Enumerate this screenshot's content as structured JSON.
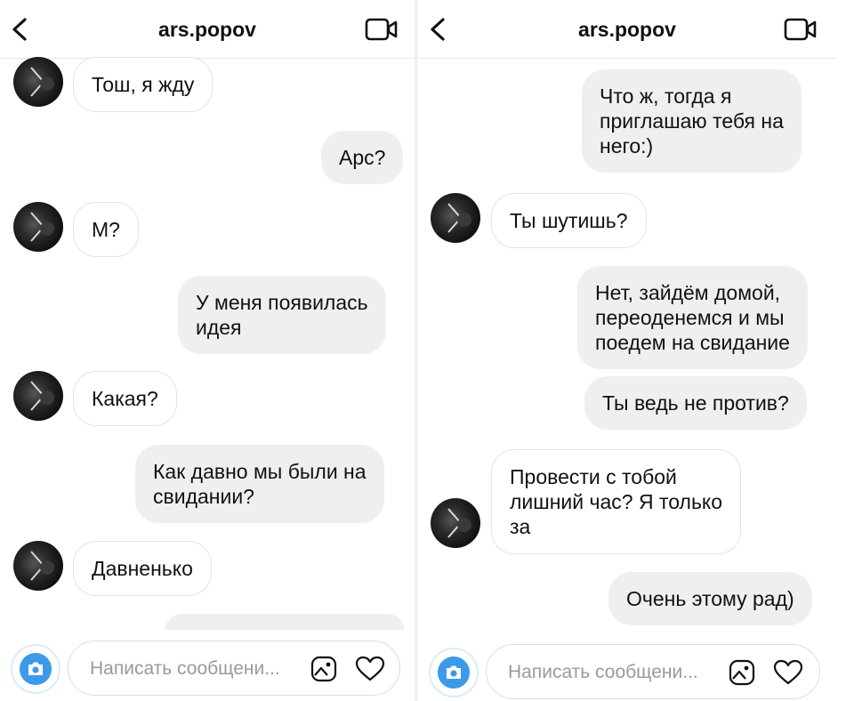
{
  "left": {
    "header": {
      "title": "ars.popov"
    },
    "messages": [
      {
        "text": "Тош, я жду"
      },
      {
        "text": "Арс?"
      },
      {
        "text": "М?"
      },
      {
        "text": "У меня появилась\nидея"
      },
      {
        "text": "Какая?"
      },
      {
        "text": "Как давно мы были на\nсвидании?"
      },
      {
        "text": "Давненько"
      }
    ],
    "composer": {
      "placeholder": "Написать сообщени..."
    }
  },
  "right": {
    "header": {
      "title": "ars.popov"
    },
    "messages": [
      {
        "text": "Что ж, тогда я\nприглашаю тебя на\nнего:)"
      },
      {
        "text": "Ты шутишь?"
      },
      {
        "text": "Нет, зайдём домой,\nпереоденемся и мы\nпоедем на свидание"
      },
      {
        "text": "Ты ведь не против?"
      },
      {
        "text": "Провести с тобой\nлишний час? Я только\nза"
      },
      {
        "text": "Очень этому рад)"
      }
    ],
    "composer": {
      "placeholder": "Написать сообщени..."
    }
  },
  "colors": {
    "accent": "#3d9ae8",
    "outgoing_bubble": "#efeff2",
    "incoming_border": "#e3e3e3"
  },
  "icons": [
    "back-icon",
    "video-call-icon",
    "camera-icon",
    "gallery-icon",
    "heart-icon",
    "avatar"
  ]
}
